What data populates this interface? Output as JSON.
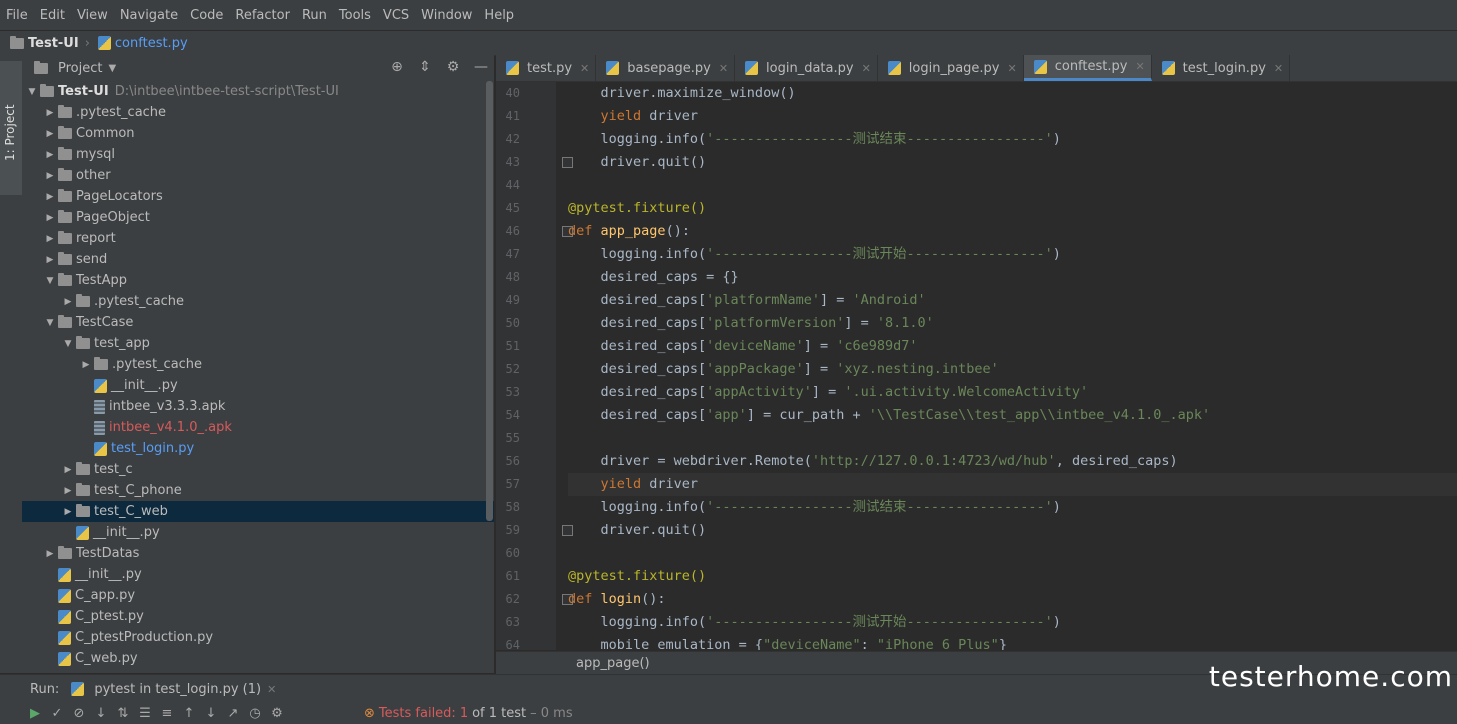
{
  "menu": [
    "File",
    "Edit",
    "View",
    "Navigate",
    "Code",
    "Refactor",
    "Run",
    "Tools",
    "VCS",
    "Window",
    "Help"
  ],
  "breadcrumb": {
    "project": "Test-UI",
    "file": "conftest.py"
  },
  "side_tab": "1: Project",
  "project_panel": {
    "title": "Project"
  },
  "tree": [
    {
      "label": "Test-UI",
      "path": "D:\\intbee\\intbee-test-script\\Test-UI",
      "depth": 0,
      "type": "folder",
      "expanded": true,
      "bold": true
    },
    {
      "label": ".pytest_cache",
      "depth": 1,
      "type": "folder"
    },
    {
      "label": "Common",
      "depth": 1,
      "type": "folder"
    },
    {
      "label": "mysql",
      "depth": 1,
      "type": "folder"
    },
    {
      "label": "other",
      "depth": 1,
      "type": "folder"
    },
    {
      "label": "PageLocators",
      "depth": 1,
      "type": "folder"
    },
    {
      "label": "PageObject",
      "depth": 1,
      "type": "folder"
    },
    {
      "label": "report",
      "depth": 1,
      "type": "folder"
    },
    {
      "label": "send",
      "depth": 1,
      "type": "folder"
    },
    {
      "label": "TestApp",
      "depth": 1,
      "type": "folder",
      "expanded": true
    },
    {
      "label": ".pytest_cache",
      "depth": 2,
      "type": "folder"
    },
    {
      "label": "TestCase",
      "depth": 1,
      "type": "folder",
      "expanded": true
    },
    {
      "label": "test_app",
      "depth": 2,
      "type": "folder",
      "expanded": true
    },
    {
      "label": ".pytest_cache",
      "depth": 3,
      "type": "folder"
    },
    {
      "label": "__init__.py",
      "depth": 3,
      "type": "py",
      "leaf": true
    },
    {
      "label": "intbee_v3.3.3.apk",
      "depth": 3,
      "type": "apk",
      "leaf": true
    },
    {
      "label": "intbee_v4.1.0_.apk",
      "depth": 3,
      "type": "apk",
      "leaf": true,
      "color": "red"
    },
    {
      "label": "test_login.py",
      "depth": 3,
      "type": "py",
      "leaf": true,
      "color": "blue"
    },
    {
      "label": "test_c",
      "depth": 2,
      "type": "folder"
    },
    {
      "label": "test_C_phone",
      "depth": 2,
      "type": "folder"
    },
    {
      "label": "test_C_web",
      "depth": 2,
      "type": "folder",
      "selected": true
    },
    {
      "label": "__init__.py",
      "depth": 2,
      "type": "py",
      "leaf": true
    },
    {
      "label": "TestDatas",
      "depth": 1,
      "type": "folder"
    },
    {
      "label": "__init__.py",
      "depth": 1,
      "type": "py",
      "leaf": true
    },
    {
      "label": "C_app.py",
      "depth": 1,
      "type": "py",
      "leaf": true
    },
    {
      "label": "C_ptest.py",
      "depth": 1,
      "type": "py",
      "leaf": true
    },
    {
      "label": "C_ptestProduction.py",
      "depth": 1,
      "type": "py",
      "leaf": true
    },
    {
      "label": "C_web.py",
      "depth": 1,
      "type": "py",
      "leaf": true
    }
  ],
  "editor_tabs": [
    {
      "label": "test.py"
    },
    {
      "label": "basepage.py"
    },
    {
      "label": "login_data.py"
    },
    {
      "label": "login_page.py"
    },
    {
      "label": "conftest.py",
      "active": true
    },
    {
      "label": "test_login.py"
    }
  ],
  "code": [
    {
      "n": "40",
      "t": "    driver.maximize_window()"
    },
    {
      "n": "41",
      "t": "    yield driver"
    },
    {
      "n": "42",
      "t": "    logging.info('-----------------测试结束-----------------')"
    },
    {
      "n": "43",
      "t": "    driver.quit()"
    },
    {
      "n": "44",
      "t": ""
    },
    {
      "n": "45",
      "t": "@pytest.fixture()"
    },
    {
      "n": "46",
      "t": "def app_page():"
    },
    {
      "n": "47",
      "t": "    logging.info('-----------------测试开始-----------------')"
    },
    {
      "n": "48",
      "t": "    desired_caps = {}"
    },
    {
      "n": "49",
      "t": "    desired_caps['platformName'] = 'Android'"
    },
    {
      "n": "50",
      "t": "    desired_caps['platformVersion'] = '8.1.0'"
    },
    {
      "n": "51",
      "t": "    desired_caps['deviceName'] = 'c6e989d7'"
    },
    {
      "n": "52",
      "t": "    desired_caps['appPackage'] = 'xyz.nesting.intbee'"
    },
    {
      "n": "53",
      "t": "    desired_caps['appActivity'] = '.ui.activity.WelcomeActivity'"
    },
    {
      "n": "54",
      "t": "    desired_caps['app'] = cur_path + '\\\\TestCase\\\\test_app\\\\intbee_v4.1.0_.apk'"
    },
    {
      "n": "55",
      "t": ""
    },
    {
      "n": "56",
      "t": "    driver = webdriver.Remote('http://127.0.0.1:4723/wd/hub', desired_caps)"
    },
    {
      "n": "57",
      "t": "    yield driver",
      "current": true
    },
    {
      "n": "58",
      "t": "    logging.info('-----------------测试结束-----------------')"
    },
    {
      "n": "59",
      "t": "    driver.quit()"
    },
    {
      "n": "60",
      "t": ""
    },
    {
      "n": "61",
      "t": "@pytest.fixture()"
    },
    {
      "n": "62",
      "t": "def login():"
    },
    {
      "n": "63",
      "t": "    logging.info('-----------------测试开始-----------------')"
    },
    {
      "n": "64",
      "t": "    mobile_emulation = {\"deviceName\": \"iPhone 6 Plus\"}"
    }
  ],
  "editor_breadcrumb": "app_page()",
  "run": {
    "label": "Run:",
    "tab": "pytest in test_login.py (1)"
  },
  "status": {
    "failed_text": "Tests failed:",
    "failed_count": "1",
    "of_text": "of 1 test",
    "time": "– 0 ms"
  },
  "watermark": "testerhome.com"
}
